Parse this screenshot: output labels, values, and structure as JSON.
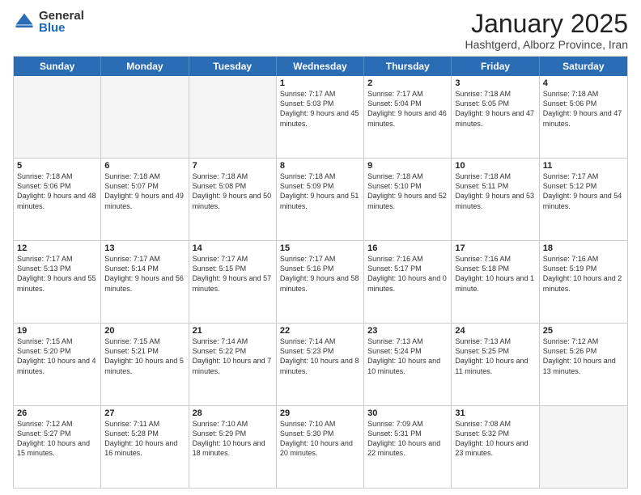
{
  "logo": {
    "general": "General",
    "blue": "Blue"
  },
  "title": "January 2025",
  "subtitle": "Hashtgerd, Alborz Province, Iran",
  "days": [
    "Sunday",
    "Monday",
    "Tuesday",
    "Wednesday",
    "Thursday",
    "Friday",
    "Saturday"
  ],
  "weeks": [
    [
      {
        "num": "",
        "info": ""
      },
      {
        "num": "",
        "info": ""
      },
      {
        "num": "",
        "info": ""
      },
      {
        "num": "1",
        "info": "Sunrise: 7:17 AM\nSunset: 5:03 PM\nDaylight: 9 hours and 45 minutes."
      },
      {
        "num": "2",
        "info": "Sunrise: 7:17 AM\nSunset: 5:04 PM\nDaylight: 9 hours and 46 minutes."
      },
      {
        "num": "3",
        "info": "Sunrise: 7:18 AM\nSunset: 5:05 PM\nDaylight: 9 hours and 47 minutes."
      },
      {
        "num": "4",
        "info": "Sunrise: 7:18 AM\nSunset: 5:06 PM\nDaylight: 9 hours and 47 minutes."
      }
    ],
    [
      {
        "num": "5",
        "info": "Sunrise: 7:18 AM\nSunset: 5:06 PM\nDaylight: 9 hours and 48 minutes."
      },
      {
        "num": "6",
        "info": "Sunrise: 7:18 AM\nSunset: 5:07 PM\nDaylight: 9 hours and 49 minutes."
      },
      {
        "num": "7",
        "info": "Sunrise: 7:18 AM\nSunset: 5:08 PM\nDaylight: 9 hours and 50 minutes."
      },
      {
        "num": "8",
        "info": "Sunrise: 7:18 AM\nSunset: 5:09 PM\nDaylight: 9 hours and 51 minutes."
      },
      {
        "num": "9",
        "info": "Sunrise: 7:18 AM\nSunset: 5:10 PM\nDaylight: 9 hours and 52 minutes."
      },
      {
        "num": "10",
        "info": "Sunrise: 7:18 AM\nSunset: 5:11 PM\nDaylight: 9 hours and 53 minutes."
      },
      {
        "num": "11",
        "info": "Sunrise: 7:17 AM\nSunset: 5:12 PM\nDaylight: 9 hours and 54 minutes."
      }
    ],
    [
      {
        "num": "12",
        "info": "Sunrise: 7:17 AM\nSunset: 5:13 PM\nDaylight: 9 hours and 55 minutes."
      },
      {
        "num": "13",
        "info": "Sunrise: 7:17 AM\nSunset: 5:14 PM\nDaylight: 9 hours and 56 minutes."
      },
      {
        "num": "14",
        "info": "Sunrise: 7:17 AM\nSunset: 5:15 PM\nDaylight: 9 hours and 57 minutes."
      },
      {
        "num": "15",
        "info": "Sunrise: 7:17 AM\nSunset: 5:16 PM\nDaylight: 9 hours and 58 minutes."
      },
      {
        "num": "16",
        "info": "Sunrise: 7:16 AM\nSunset: 5:17 PM\nDaylight: 10 hours and 0 minutes."
      },
      {
        "num": "17",
        "info": "Sunrise: 7:16 AM\nSunset: 5:18 PM\nDaylight: 10 hours and 1 minute."
      },
      {
        "num": "18",
        "info": "Sunrise: 7:16 AM\nSunset: 5:19 PM\nDaylight: 10 hours and 2 minutes."
      }
    ],
    [
      {
        "num": "19",
        "info": "Sunrise: 7:15 AM\nSunset: 5:20 PM\nDaylight: 10 hours and 4 minutes."
      },
      {
        "num": "20",
        "info": "Sunrise: 7:15 AM\nSunset: 5:21 PM\nDaylight: 10 hours and 5 minutes."
      },
      {
        "num": "21",
        "info": "Sunrise: 7:14 AM\nSunset: 5:22 PM\nDaylight: 10 hours and 7 minutes."
      },
      {
        "num": "22",
        "info": "Sunrise: 7:14 AM\nSunset: 5:23 PM\nDaylight: 10 hours and 8 minutes."
      },
      {
        "num": "23",
        "info": "Sunrise: 7:13 AM\nSunset: 5:24 PM\nDaylight: 10 hours and 10 minutes."
      },
      {
        "num": "24",
        "info": "Sunrise: 7:13 AM\nSunset: 5:25 PM\nDaylight: 10 hours and 11 minutes."
      },
      {
        "num": "25",
        "info": "Sunrise: 7:12 AM\nSunset: 5:26 PM\nDaylight: 10 hours and 13 minutes."
      }
    ],
    [
      {
        "num": "26",
        "info": "Sunrise: 7:12 AM\nSunset: 5:27 PM\nDaylight: 10 hours and 15 minutes."
      },
      {
        "num": "27",
        "info": "Sunrise: 7:11 AM\nSunset: 5:28 PM\nDaylight: 10 hours and 16 minutes."
      },
      {
        "num": "28",
        "info": "Sunrise: 7:10 AM\nSunset: 5:29 PM\nDaylight: 10 hours and 18 minutes."
      },
      {
        "num": "29",
        "info": "Sunrise: 7:10 AM\nSunset: 5:30 PM\nDaylight: 10 hours and 20 minutes."
      },
      {
        "num": "30",
        "info": "Sunrise: 7:09 AM\nSunset: 5:31 PM\nDaylight: 10 hours and 22 minutes."
      },
      {
        "num": "31",
        "info": "Sunrise: 7:08 AM\nSunset: 5:32 PM\nDaylight: 10 hours and 23 minutes."
      },
      {
        "num": "",
        "info": ""
      }
    ]
  ]
}
